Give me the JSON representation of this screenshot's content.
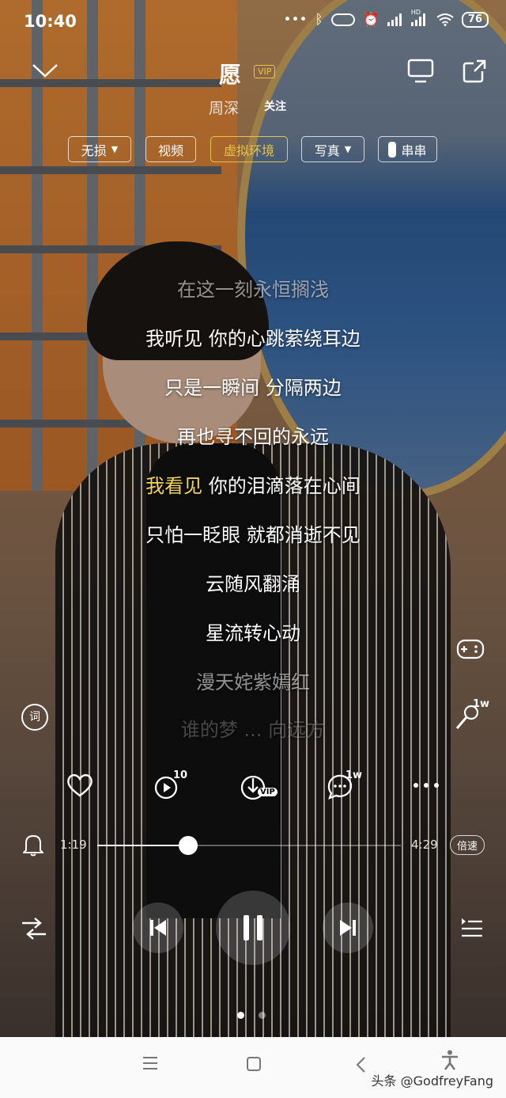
{
  "status_bar": {
    "time": "10:40",
    "icons": [
      "dots-icon",
      "bluetooth-icon",
      "vpn-icon",
      "alarm-icon",
      "signal-icon",
      "signal-hd-icon",
      "wifi-icon"
    ],
    "hd_label": "HD",
    "battery": "76"
  },
  "header": {
    "song_title": "愿",
    "vip_tag": "VIP",
    "artist": "周深",
    "follow_label": "关注"
  },
  "options": {
    "quality": "无损",
    "video": "视频",
    "virtual_env": "虚拟环境",
    "photo": "写真",
    "chuan": "串串"
  },
  "lyrics": {
    "line1": "在这一刻永恒搁浅",
    "line2": "我听见 你的心跳萦绕耳边",
    "line3": "只是一瞬间 分隔两边",
    "line4": "再也寻不回的永远",
    "line5_highlight": "我看见",
    "line5_rest": " 你的泪滴落在心间",
    "line6": "只怕一眨眼 就都消逝不见",
    "line7": "云随风翻涌",
    "line8": "星流转心动",
    "line9": "漫天姹紫嫣红",
    "line10": "谁的梦 ... 向远方"
  },
  "side": {
    "lyric_icon_label": "词",
    "karaoke_badge": "1w"
  },
  "actions": {
    "play_count_badge": "10",
    "download_badge": "VIP",
    "comment_badge": "1w"
  },
  "progress": {
    "current": "1:19",
    "total": "4:29",
    "fraction": 0.3,
    "speed_label": "倍速"
  },
  "pager": {
    "count": 2,
    "active": 0
  },
  "watermark": "头条 @GodfreyFang"
}
